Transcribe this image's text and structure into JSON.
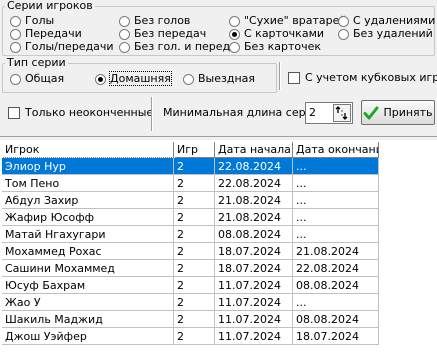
{
  "series_players": {
    "legend": "Серии игроков",
    "options": [
      {
        "label": "Голы",
        "selected": false
      },
      {
        "label": "Передачи",
        "selected": false
      },
      {
        "label": "Голы/передачи",
        "selected": false
      },
      {
        "label": "Без голов",
        "selected": false
      },
      {
        "label": "Без передач",
        "selected": false
      },
      {
        "label": "Без гол. и перед.",
        "selected": false
      },
      {
        "label": "\"Сухие\" вратарей",
        "selected": false
      },
      {
        "label": "С карточками",
        "selected": true
      },
      {
        "label": "Без карточек",
        "selected": false
      },
      {
        "label": "С удалениями",
        "selected": false
      },
      {
        "label": "Без удалений",
        "selected": false
      }
    ]
  },
  "series_type": {
    "legend": "Тип серии",
    "options": [
      {
        "label": "Общая",
        "selected": false
      },
      {
        "label": "Домашняя",
        "selected": true
      },
      {
        "label": "Выездная",
        "selected": false
      }
    ]
  },
  "cup_games": {
    "label": "С учетом кубковых игр",
    "checked": false
  },
  "only_unfinished": {
    "label": "Только неоконченные",
    "checked": false
  },
  "min_length": {
    "label": "Минимальная длина серии",
    "value": "2"
  },
  "apply_button": {
    "label": "Принять"
  },
  "colors": {
    "selection": "#0078d7",
    "check_icon": "#1ea81e"
  },
  "table": {
    "columns": [
      "Игрок",
      "Игр",
      "Дата начала",
      "Дата окончания"
    ],
    "selected_row": 0,
    "rows": [
      [
        "Элиор Нур",
        "2",
        "22.08.2024",
        "..."
      ],
      [
        "Том Пено",
        "2",
        "22.08.2024",
        "..."
      ],
      [
        "Абдул Захир",
        "2",
        "21.08.2024",
        "..."
      ],
      [
        "Жафир Юсофф",
        "2",
        "21.08.2024",
        "..."
      ],
      [
        "Матай Нгахугари",
        "2",
        "08.08.2024",
        "..."
      ],
      [
        "Мохаммед Рохас",
        "2",
        "18.07.2024",
        "21.08.2024"
      ],
      [
        "Сашини Мохаммед",
        "2",
        "18.07.2024",
        "22.08.2024"
      ],
      [
        "Юсуф Бахрам",
        "2",
        "11.07.2024",
        "08.08.2024"
      ],
      [
        "Жао У",
        "2",
        "11.07.2024",
        "..."
      ],
      [
        "Шакиль Маджид",
        "2",
        "11.07.2024",
        "08.08.2024"
      ],
      [
        "Джош Уэйфер",
        "2",
        "11.07.2024",
        "18.07.2024"
      ]
    ]
  }
}
